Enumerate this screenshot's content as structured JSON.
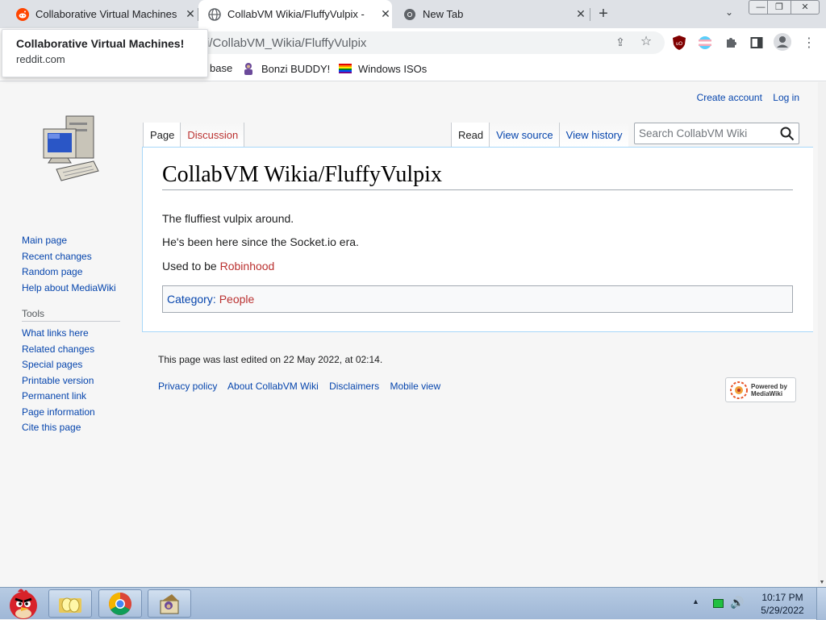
{
  "browser": {
    "tabs": [
      {
        "title": "Collaborative Virtual Machines",
        "favicon": "reddit-icon"
      },
      {
        "title": "CollabVM Wikia/FluffyVulpix -",
        "favicon": "globe-icon"
      },
      {
        "title": "New Tab",
        "favicon": "chrome-icon"
      }
    ],
    "address": "i/CollabVM_Wikia/FluffyVulpix",
    "bookmarks": [
      "base",
      "Bonzi BUDDY!",
      "Windows ISOs"
    ],
    "tooltip": {
      "title": "Collaborative Virtual Machines!",
      "url": "reddit.com"
    }
  },
  "wiki": {
    "personal": {
      "create_account": "Create account",
      "log_in": "Log in"
    },
    "tabs_left": [
      "Page",
      "Discussion"
    ],
    "tabs_right": [
      "Read",
      "View source",
      "View history"
    ],
    "search_placeholder": "Search CollabVM Wiki",
    "title": "CollabVM Wikia/FluffyVulpix",
    "paragraphs": {
      "p1": "The fluffiest vulpix around.",
      "p2": "He's been here since the Socket.io era.",
      "p3_prefix": "Used to be ",
      "p3_link": "Robinhood"
    },
    "category_label": "Category",
    "category_item": "People",
    "nav": [
      "Main page",
      "Recent changes",
      "Random page",
      "Help about MediaWiki"
    ],
    "tools_heading": "Tools",
    "tools": [
      "What links here",
      "Related changes",
      "Special pages",
      "Printable version",
      "Permanent link",
      "Page information",
      "Cite this page"
    ],
    "last_modified": "This page was last edited on 22 May 2022, at 02:14.",
    "footer_links": [
      "Privacy policy",
      "About CollabVM Wiki",
      "Disclaimers",
      "Mobile view"
    ],
    "powered_by": {
      "line1": "Powered by",
      "line2": "MediaWiki"
    }
  },
  "taskbar": {
    "time": "10:17 PM",
    "date": "5/29/2022"
  },
  "colors": {
    "link": "#0645ad",
    "redlink": "#ba3130",
    "content_border": "#a7d7f9"
  }
}
